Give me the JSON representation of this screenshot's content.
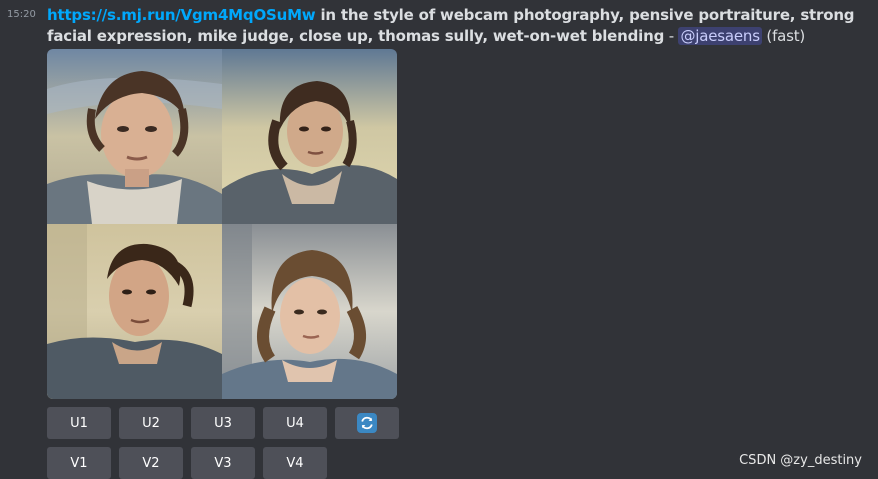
{
  "message": {
    "timestamp": "15:20",
    "link_text": "https://s.mj.run/Vgm4MqOSuMw",
    "prompt_text": " in the style of webcam photography, pensive portraiture, strong facial expression, mike judge, close up, thomas sully, wet-on-wet blending",
    "separator": " - ",
    "mention": "@jaesaens",
    "mode": " (fast)"
  },
  "image_grid": {
    "cells": [
      "portrait-1",
      "portrait-2",
      "portrait-3",
      "portrait-4"
    ]
  },
  "buttons": {
    "upscale": [
      "U1",
      "U2",
      "U3",
      "U4"
    ],
    "variation": [
      "V1",
      "V2",
      "V3",
      "V4"
    ],
    "reroll_icon": "refresh-icon"
  },
  "watermark": "CSDN @zy_destiny",
  "colors": {
    "background": "#313338",
    "link": "#00a8fc",
    "button": "#4e5058",
    "mention_bg": "#4b4f8a",
    "reroll": "#3b88c3"
  }
}
